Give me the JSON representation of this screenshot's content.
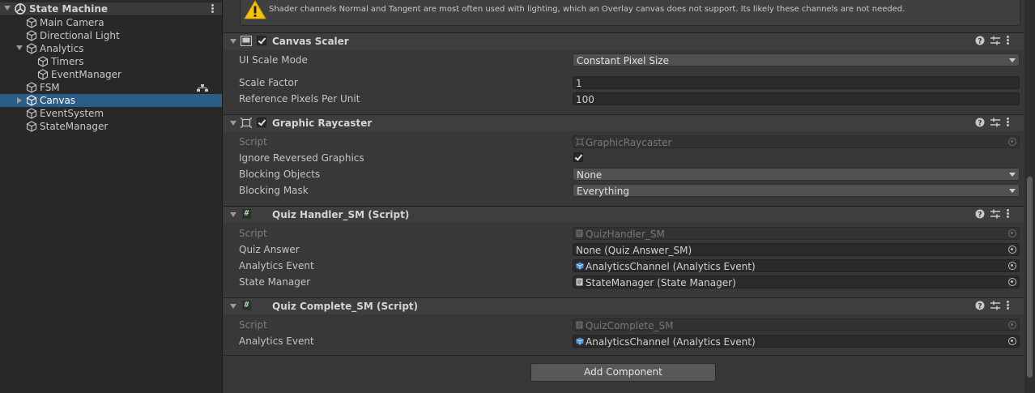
{
  "hierarchy": {
    "scene_title": "State Machine",
    "items": [
      {
        "label": "Main Camera"
      },
      {
        "label": "Directional Light"
      },
      {
        "label": "Analytics"
      },
      {
        "label": "Timers"
      },
      {
        "label": "EventManager"
      },
      {
        "label": "FSM"
      },
      {
        "label": "Canvas"
      },
      {
        "label": "EventSystem"
      },
      {
        "label": "StateManager"
      }
    ]
  },
  "warning": {
    "text": "Shader channels Normal and Tangent are most often used with lighting, which an Overlay canvas does not support. Its likely these channels are not needed."
  },
  "canvas_scaler": {
    "title": "Canvas Scaler",
    "enabled": true,
    "ui_scale_mode_label": "UI Scale Mode",
    "ui_scale_mode_value": "Constant Pixel Size",
    "scale_factor_label": "Scale Factor",
    "scale_factor_value": "1",
    "ref_ppu_label": "Reference Pixels Per Unit",
    "ref_ppu_value": "100"
  },
  "graphic_raycaster": {
    "title": "Graphic Raycaster",
    "enabled": true,
    "script_label": "Script",
    "script_value": "GraphicRaycaster",
    "ignore_reversed_label": "Ignore Reversed Graphics",
    "ignore_reversed_value": true,
    "blocking_objects_label": "Blocking Objects",
    "blocking_objects_value": "None",
    "blocking_mask_label": "Blocking Mask",
    "blocking_mask_value": "Everything"
  },
  "quiz_handler": {
    "title": "Quiz Handler_SM (Script)",
    "script_label": "Script",
    "script_value": "QuizHandler_SM",
    "quiz_answer_label": "Quiz Answer",
    "quiz_answer_value": "None (Quiz Answer_SM)",
    "analytics_event_label": "Analytics Event",
    "analytics_event_value": "AnalyticsChannel (Analytics Event)",
    "state_manager_label": "State Manager",
    "state_manager_value": "StateManager (State Manager)"
  },
  "quiz_complete": {
    "title": "Quiz Complete_SM (Script)",
    "script_label": "Script",
    "script_value": "QuizComplete_SM",
    "analytics_event_label": "Analytics Event",
    "analytics_event_value": "AnalyticsChannel (Analytics Event)"
  },
  "add_component_label": "Add Component",
  "colors": {
    "selection": "#2c5d87",
    "panel": "#383838",
    "hierarchy_bg": "#282828",
    "warning_yellow": "#f4c20d"
  }
}
